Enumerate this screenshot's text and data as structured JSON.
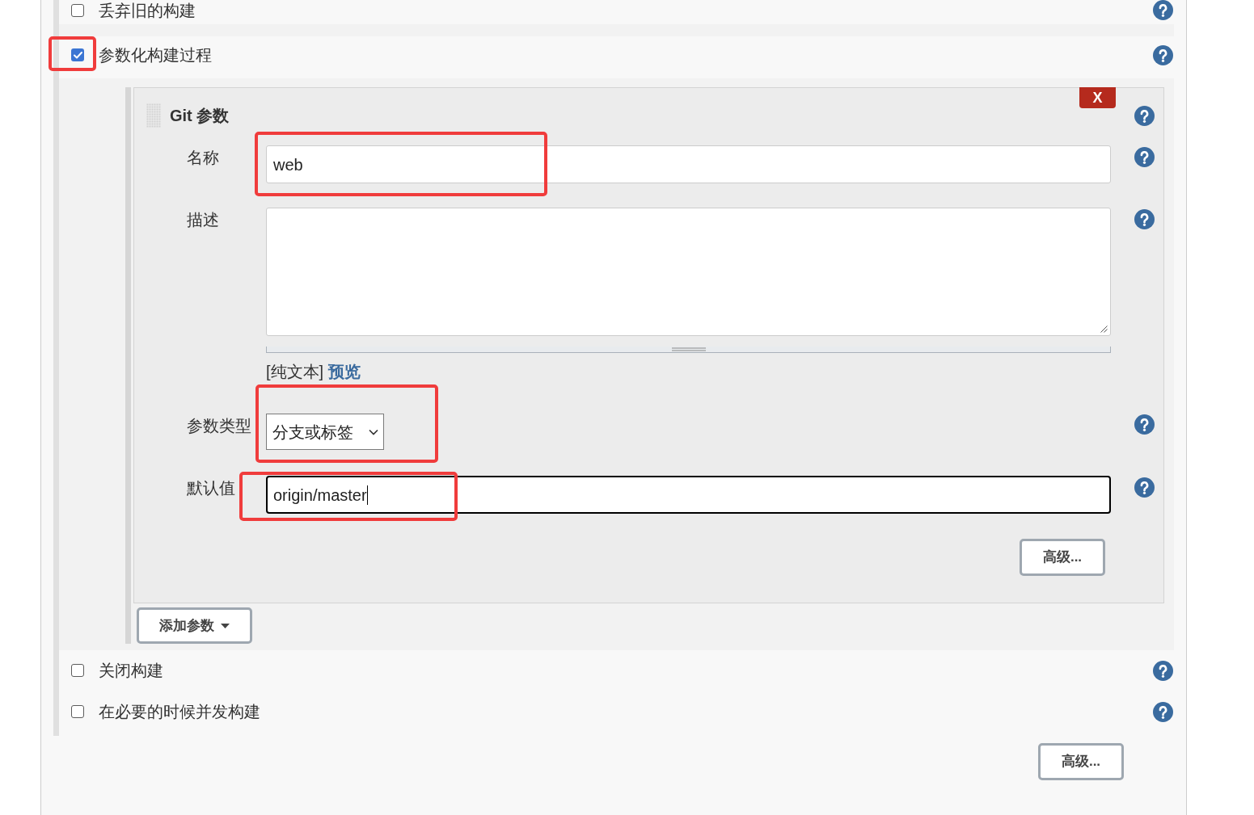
{
  "build_options": [
    {
      "label": "丢弃旧的构建",
      "checked": false,
      "highlighted": false
    },
    {
      "label": "参数化构建过程",
      "checked": true,
      "highlighted": true,
      "parameters": {
        "items": [
          {
            "kind": "git",
            "title": "Git 参数",
            "remove_button": "X",
            "fields": [
              {
                "kind": "text",
                "label": "名称",
                "value": "web",
                "highlighted": true,
                "focused": false
              },
              {
                "kind": "textarea",
                "label": "描述",
                "markup_mode": "[纯文本]",
                "preview_link": "预览"
              },
              {
                "kind": "select",
                "label": "参数类型",
                "value": "分支或标签",
                "highlighted": true
              },
              {
                "kind": "text",
                "label": "默认值",
                "value": "origin/master",
                "highlighted": true,
                "focused": true
              }
            ],
            "advanced_button": "高级..."
          }
        ],
        "add_button": "添加参数"
      }
    },
    {
      "label": "关闭构建",
      "checked": false,
      "highlighted": false
    },
    {
      "label": "在必要的时候并发构建",
      "checked": false,
      "highlighted": false
    }
  ],
  "advanced_button": "高级..."
}
